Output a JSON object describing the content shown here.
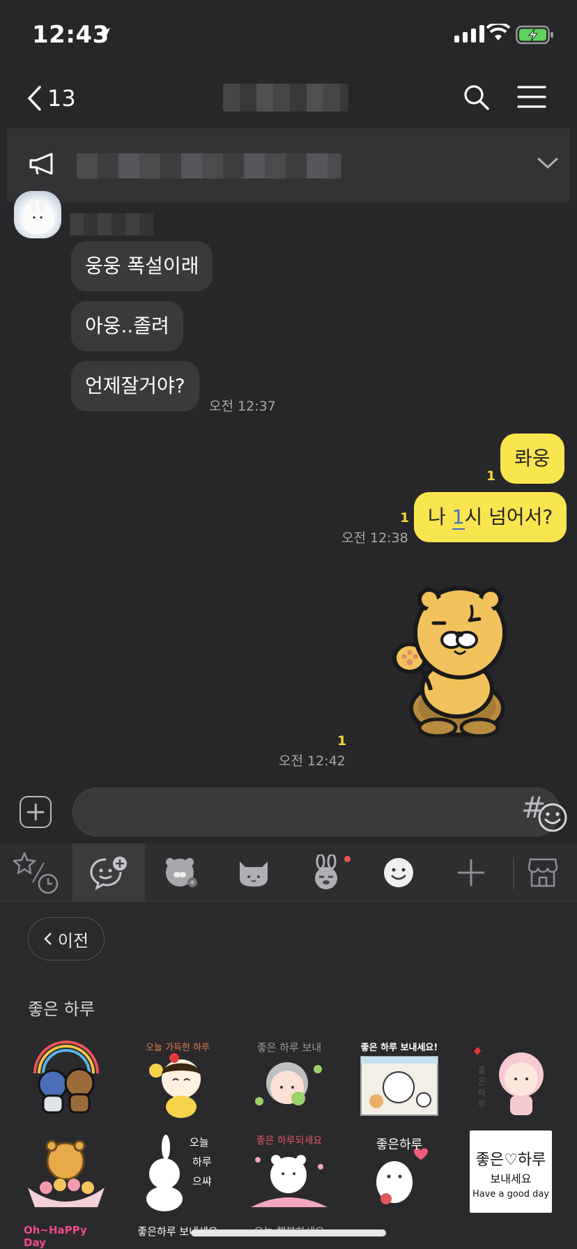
{
  "status_bar": {
    "time": "12:43"
  },
  "header": {
    "back_count": "13"
  },
  "messages_in": [
    {
      "text": "웅웅 폭설이래"
    },
    {
      "text": "아웅..졸려"
    },
    {
      "text": "언제잘거야?"
    }
  ],
  "messages_in_time": "오전 12:37",
  "messages_out": [
    {
      "text_prefix": "롸웅",
      "unread": "1"
    },
    {
      "text_prefix": "나 ",
      "text_highlight": "1",
      "text_suffix": "시 넘어서?",
      "unread": "1",
      "time": "오전 12:38"
    }
  ],
  "sticker_message": {
    "unread": "1",
    "time": "오전 12:42"
  },
  "input": {
    "placeholder": "",
    "hash": "#"
  },
  "panel": {
    "prev_label": "이전",
    "section_title": "좋은 하루",
    "stickers_row1": [
      {
        "label": ""
      },
      {
        "label": "오늘 가득한 하루"
      },
      {
        "label": "좋은 하루 보내"
      },
      {
        "label": "좋은 하루 보내세요!"
      },
      {
        "label": "좋은 하루 보내"
      }
    ],
    "stickers_row2": [
      {
        "label": ""
      },
      {
        "label": "오늘 하루도 으쌰으쌰"
      },
      {
        "label": "좋은 하루되세요"
      },
      {
        "label": "좋은하루"
      },
      {
        "label_line1": "좋은♡하루",
        "label_line2": "보내세요",
        "label_line3": "Have a good day"
      }
    ],
    "stickers_row3": [
      {
        "label": "Oh~HaPPy Day"
      },
      {
        "label": "좋은하루 보내세요"
      },
      {
        "label": "오늘 행복하세요"
      }
    ]
  },
  "colors": {
    "background": "#27272a",
    "my_bubble": "#f9e54e",
    "other_bubble": "#3a3a3c",
    "unread": "#f5d73c"
  }
}
